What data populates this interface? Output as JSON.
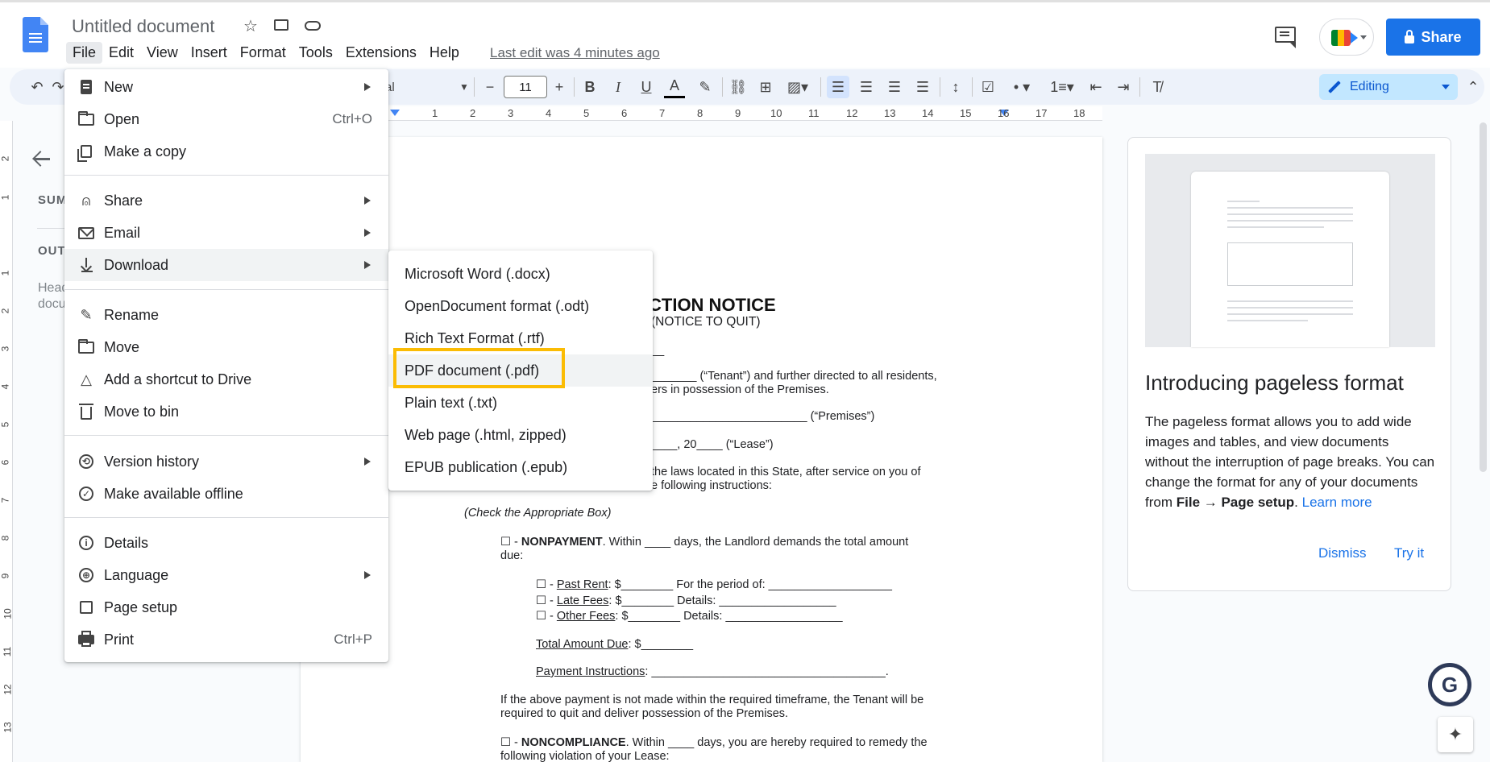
{
  "header": {
    "doc_title": "Untitled document",
    "menu": [
      "File",
      "Edit",
      "View",
      "Insert",
      "Format",
      "Tools",
      "Extensions",
      "Help"
    ],
    "last_edit": "Last edit was 4 minutes ago",
    "share_label": "Share"
  },
  "toolbar": {
    "font_name_fragment": "al",
    "font_size": "11",
    "mode_label": "Editing"
  },
  "ruler": {
    "numbers": [
      "1",
      "2",
      "3",
      "4",
      "5",
      "6",
      "7",
      "8",
      "9",
      "10",
      "11",
      "12",
      "13",
      "14",
      "15",
      "16",
      "17",
      "18"
    ]
  },
  "vruler": {
    "numbers": [
      "2",
      "1",
      "1",
      "2",
      "3",
      "4",
      "5",
      "6",
      "7",
      "8",
      "9",
      "10",
      "11",
      "12",
      "13"
    ]
  },
  "left_panel": {
    "summary_label": "SUM",
    "outline_label": "OUT",
    "hint_line1": "Head",
    "hint_line2": "docu"
  },
  "file_menu": {
    "new": "New",
    "open": "Open",
    "open_shortcut": "Ctrl+O",
    "make_copy": "Make a copy",
    "share": "Share",
    "email": "Email",
    "download": "Download",
    "rename": "Rename",
    "move": "Move",
    "add_shortcut": "Add a shortcut to Drive",
    "move_to_bin": "Move to bin",
    "version_history": "Version history",
    "make_offline": "Make available offline",
    "details": "Details",
    "language": "Language",
    "page_setup": "Page setup",
    "print": "Print",
    "print_shortcut": "Ctrl+P"
  },
  "download_menu": {
    "docx": "Microsoft Word (.docx)",
    "odt": "OpenDocument format (.odt)",
    "rtf": "Rich Text Format (.rtf)",
    "pdf": "PDF document (.pdf)",
    "txt": "Plain text (.txt)",
    "html": "Web page (.html, zipped)",
    "epub": "EPUB publication (.epub)"
  },
  "document": {
    "heading_fragment": "CTION NOTICE",
    "subheading_fragment": "(NOTICE TO QUIT)",
    "line_blank": "__",
    "tenant_line": "_______ (“Tenant”) and further directed to all residents,",
    "tenant_line2": "ers in possession of the Premises.",
    "premises_line": "________________________ (“Premises”)",
    "lease_line": "____, 20____ (“Lease”)",
    "state_line": "the laws located in this State, after service on you of",
    "state_line2": "e following instructions:",
    "check_box": "(Check the Appropriate Box)",
    "nonpayment_prefix": "☐ - ",
    "nonpayment_bold": "NONPAYMENT",
    "nonpayment_rest": ". Within ____ days, the Landlord demands the total amount",
    "nonpayment_due": "due:",
    "past_rent_prefix": "☐ - ",
    "past_rent_label": "Past Rent",
    "past_rent_rest": ": $________ For the period of: ___________________",
    "late_fees_prefix": "☐ - ",
    "late_fees_label": "Late Fees",
    "late_fees_rest": ": $________ Details: __________________",
    "other_fees_prefix": "☐ - ",
    "other_fees_label": "Other Fees",
    "other_fees_rest": ": $________ Details: __________________",
    "total_label": "Total Amount Due",
    "total_rest": ": $________",
    "payment_label": "Payment Instructions",
    "payment_rest": ": ____________________________________.",
    "quit_line1": "If the above payment is not made within the required timeframe, the Tenant will be",
    "quit_line2": "required to quit and deliver possession of the Premises.",
    "noncomp_prefix": "☐ - ",
    "noncomp_bold": "NONCOMPLIANCE",
    "noncomp_rest": ". Within ____ days, you are hereby required to remedy the",
    "noncomp_line2": "following violation of your Lease:"
  },
  "pageless_card": {
    "title": "Introducing pageless format",
    "body_1": "The pageless format allows you to add wide images and tables, and view documents without the interruption of page breaks. You can change the format for any of your documents from ",
    "body_bold": "File → Page setup",
    "body_2": ". ",
    "learn_more": "Learn more",
    "dismiss": "Dismiss",
    "try_it": "Try it"
  },
  "colors": {
    "accent": "#1a73e8",
    "highlight": "#fbbc04",
    "toolbar_bg": "#edf2fa"
  }
}
